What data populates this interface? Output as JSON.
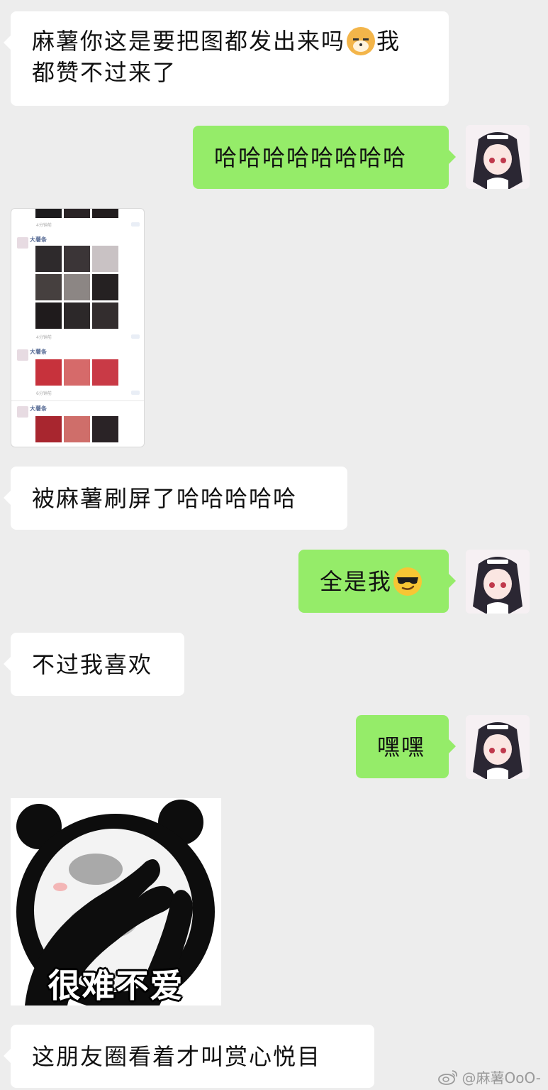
{
  "messages": [
    {
      "side": "in",
      "text_a": "麻薯你这是要把图都发出来吗",
      "emoji": "cat-face-emoji",
      "text_b": "我",
      "text_c": "都赞不过来了"
    },
    {
      "side": "out",
      "text": "哈哈哈哈哈哈哈哈"
    },
    {
      "side": "in",
      "type": "image",
      "content": "moments-screenshot"
    },
    {
      "side": "in",
      "text": "被麻薯刷屏了哈哈哈哈哈"
    },
    {
      "side": "out",
      "text": "全是我",
      "emoji": "sunglasses-emoji"
    },
    {
      "side": "in",
      "text": "不过我喜欢"
    },
    {
      "side": "out",
      "text": "嘿嘿"
    },
    {
      "side": "in",
      "type": "sticker",
      "caption": "很难不爱"
    },
    {
      "side": "in",
      "text": "这朋友圈看着才叫赏心悦目"
    }
  ],
  "moments_screenshot": {
    "poster_name": "大薯条",
    "time_a": "4分钟前",
    "time_b": "4分钟前",
    "time_c": "6分钟前"
  },
  "watermark": {
    "handle": "@麻薯OoO-",
    "icon": "weibo-logo-icon"
  },
  "colors": {
    "background": "#ededed",
    "incoming": "#ffffff",
    "outgoing": "#95ec69"
  }
}
